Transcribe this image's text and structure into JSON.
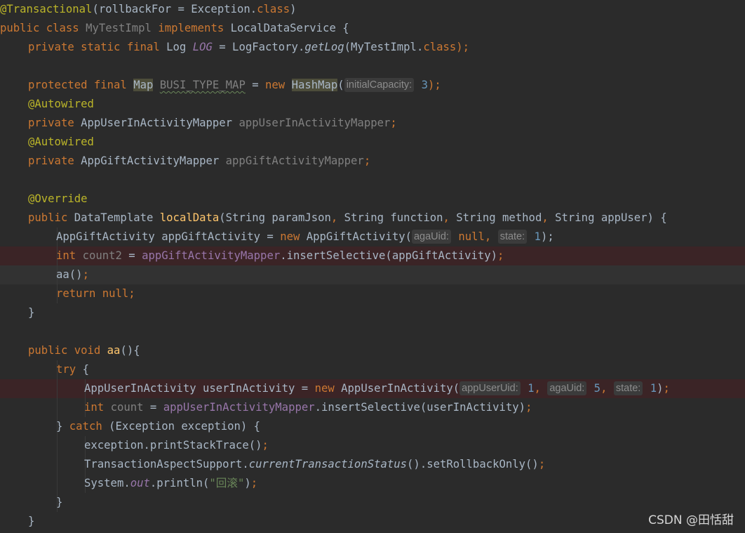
{
  "watermark": "CSDN @田恬甜",
  "lines": [
    {
      "indent": 0,
      "tokens": [
        [
          "ann",
          "@Transactional"
        ],
        [
          "",
          "(rollbackFor = Exception."
        ],
        [
          "kw",
          "class"
        ],
        [
          "",
          ")"
        ]
      ]
    },
    {
      "indent": 0,
      "tokens": [
        [
          "kw",
          "public class "
        ],
        [
          "gry",
          "MyTestImpl "
        ],
        [
          "kw",
          "implements "
        ],
        [
          "",
          "LocalDataService {"
        ]
      ]
    },
    {
      "indent": 1,
      "tokens": [
        [
          "kw",
          "private static final "
        ],
        [
          "",
          "Log "
        ],
        [
          "ifld",
          "LOG"
        ],
        [
          "",
          " = LogFactory."
        ],
        [
          "it",
          "getLog"
        ],
        [
          "",
          "(MyTestImpl."
        ],
        [
          "kw",
          "class"
        ],
        [
          "kw",
          ");"
        ]
      ]
    },
    {
      "indent": 0,
      "tokens": []
    },
    {
      "indent": 1,
      "tokens": [
        [
          "kw",
          "protected final "
        ],
        [
          "hl",
          "Map"
        ],
        [
          "",
          " "
        ],
        [
          "gry ul",
          "BUSI_TYPE_MAP"
        ],
        [
          "",
          " = "
        ],
        [
          "kw",
          "new "
        ],
        [
          "hl",
          "HashMap"
        ],
        [
          "",
          "("
        ],
        [
          "hint",
          "initialCapacity:"
        ],
        [
          "num",
          " 3"
        ],
        [
          "kw",
          ");"
        ]
      ]
    },
    {
      "indent": 1,
      "tokens": [
        [
          "ann",
          "@Autowired"
        ]
      ]
    },
    {
      "indent": 1,
      "tokens": [
        [
          "kw",
          "private "
        ],
        [
          "",
          "AppUserInActivityMapper "
        ],
        [
          "gry",
          "appUserInActivityMapper"
        ],
        [
          "kw",
          ";"
        ]
      ]
    },
    {
      "indent": 1,
      "tokens": [
        [
          "ann",
          "@Autowired"
        ]
      ]
    },
    {
      "indent": 1,
      "tokens": [
        [
          "kw",
          "private "
        ],
        [
          "",
          "AppGiftActivityMapper "
        ],
        [
          "gry",
          "appGiftActivityMapper"
        ],
        [
          "kw",
          ";"
        ]
      ]
    },
    {
      "indent": 0,
      "tokens": []
    },
    {
      "indent": 1,
      "tokens": [
        [
          "ann",
          "@Override"
        ]
      ]
    },
    {
      "indent": 1,
      "tokens": [
        [
          "kw",
          "public "
        ],
        [
          "",
          "DataTemplate "
        ],
        [
          "fn",
          "localData"
        ],
        [
          "",
          "(String paramJson"
        ],
        [
          "kw",
          ", "
        ],
        [
          "",
          "String function"
        ],
        [
          "kw",
          ", "
        ],
        [
          "",
          "String method"
        ],
        [
          "kw",
          ", "
        ],
        [
          "",
          "String appUser) {"
        ]
      ]
    },
    {
      "indent": 2,
      "tokens": [
        [
          "",
          "AppGiftActivity appGiftActivity = "
        ],
        [
          "kw",
          "new "
        ],
        [
          "",
          "AppGiftActivity("
        ],
        [
          "hint",
          "agaUid:"
        ],
        [
          "kw",
          " null, "
        ],
        [
          "hint",
          "state:"
        ],
        [
          "num",
          " 1"
        ],
        [
          "",
          "); "
        ]
      ]
    },
    {
      "indent": 2,
      "style": "err",
      "tokens": [
        [
          "kw",
          "int "
        ],
        [
          "gry",
          "count2 "
        ],
        [
          "",
          "= "
        ],
        [
          "fld",
          "appGiftActivityMapper"
        ],
        [
          "",
          ".insertSelective(appGiftActivity)"
        ],
        [
          "kw",
          ";"
        ]
      ]
    },
    {
      "indent": 2,
      "style": "cur",
      "tokens": [
        [
          "",
          "aa()"
        ],
        [
          "kw",
          ";"
        ]
      ]
    },
    {
      "indent": 2,
      "tokens": [
        [
          "kw",
          "return null;"
        ]
      ]
    },
    {
      "indent": 1,
      "tokens": [
        [
          "",
          "}"
        ]
      ]
    },
    {
      "indent": 0,
      "tokens": []
    },
    {
      "indent": 1,
      "tokens": [
        [
          "kw",
          "public void "
        ],
        [
          "fn",
          "aa"
        ],
        [
          "",
          "(){"
        ]
      ]
    },
    {
      "indent": 2,
      "tokens": [
        [
          "kw",
          "try "
        ],
        [
          "",
          "{"
        ]
      ]
    },
    {
      "indent": 3,
      "style": "err",
      "tokens": [
        [
          "",
          "AppUserInActivity userInActivity = "
        ],
        [
          "kw",
          "new "
        ],
        [
          "",
          "AppUserInActivity("
        ],
        [
          "hint",
          "appUserUid:"
        ],
        [
          "num",
          " 1"
        ],
        [
          "kw",
          ", "
        ],
        [
          "hint",
          "agaUid:"
        ],
        [
          "num",
          " 5"
        ],
        [
          "kw",
          ", "
        ],
        [
          "hint",
          "state:"
        ],
        [
          "num",
          " 1"
        ],
        [
          "",
          ")"
        ],
        [
          "kw",
          ";"
        ]
      ]
    },
    {
      "indent": 3,
      "tokens": [
        [
          "kw",
          "int "
        ],
        [
          "gry",
          "count "
        ],
        [
          "",
          "= "
        ],
        [
          "fld",
          "appUserInActivityMapper"
        ],
        [
          "",
          ".insertSelective(userInActivity)"
        ],
        [
          "kw",
          ";"
        ]
      ]
    },
    {
      "indent": 2,
      "tokens": [
        [
          "",
          "} "
        ],
        [
          "kw",
          "catch "
        ],
        [
          "",
          "(Exception exception) {"
        ]
      ]
    },
    {
      "indent": 3,
      "tokens": [
        [
          "",
          "exception.printStackTrace()"
        ],
        [
          "kw",
          ";"
        ]
      ]
    },
    {
      "indent": 3,
      "tokens": [
        [
          "",
          "TransactionAspectSupport."
        ],
        [
          "it",
          "currentTransactionStatus"
        ],
        [
          "",
          "().setRollbackOnly()"
        ],
        [
          "kw",
          ";"
        ]
      ]
    },
    {
      "indent": 3,
      "tokens": [
        [
          "",
          "System."
        ],
        [
          "ifld",
          "out"
        ],
        [
          "",
          ".println("
        ],
        [
          "str",
          "\"回滚\""
        ],
        [
          "",
          ")"
        ],
        [
          "kw",
          ";"
        ]
      ]
    },
    {
      "indent": 2,
      "tokens": [
        [
          "",
          "}"
        ]
      ]
    },
    {
      "indent": 1,
      "tokens": [
        [
          "",
          "}"
        ]
      ]
    }
  ]
}
